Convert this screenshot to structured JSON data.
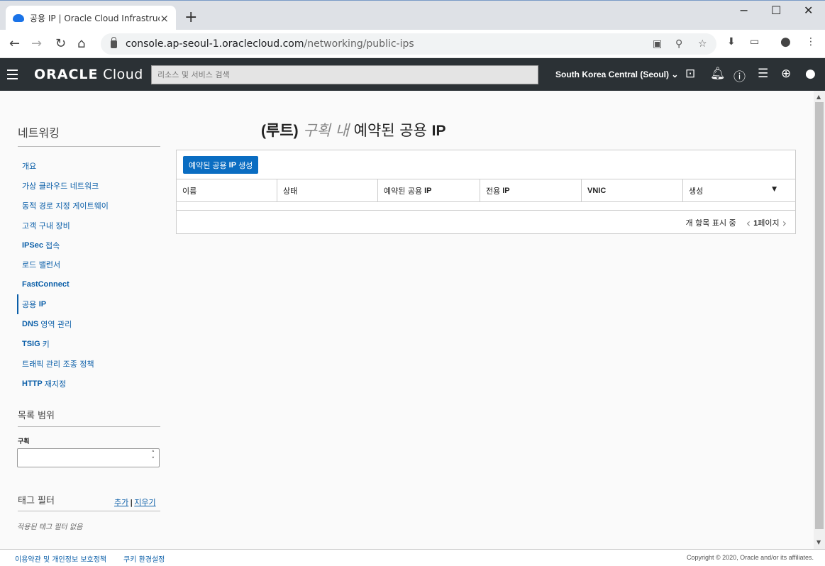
{
  "browser": {
    "tab_title": "공용 IP | Oracle Cloud Infrastructure",
    "tab_close": "×",
    "new_tab": "+",
    "url_host": "console.ap-seoul-1.oraclecloud.com",
    "url_path": "/networking/public-ips",
    "window_controls": [
      "−",
      "☐",
      "✕"
    ]
  },
  "header": {
    "logo_brand": "ORACLE",
    "logo_product": "Cloud",
    "search_placeholder": "리소스 및 서비스 검색",
    "region": "South Korea Central (Seoul)",
    "region_caret": "⌄",
    "icons": [
      "cloud-shell-icon",
      "bell-icon",
      "help-icon",
      "chat-icon",
      "globe-icon",
      "user-icon"
    ]
  },
  "sidebar": {
    "title": "네트워킹",
    "items": [
      {
        "label": "개요",
        "bold": ""
      },
      {
        "label": "가상 클라우드 네트워크",
        "bold": ""
      },
      {
        "label": "동적 경로 지정 게이트웨이",
        "bold": ""
      },
      {
        "label": "고객 구내 장비",
        "bold": ""
      },
      {
        "label": "접속",
        "bold": "IPSec"
      },
      {
        "label": "로드 밸런서",
        "bold": ""
      },
      {
        "label": "",
        "bold": "FastConnect"
      },
      {
        "label": "공용",
        "bold": "",
        "suffix": "IP",
        "active": true
      },
      {
        "label": "영역 관리",
        "bold": "DNS"
      },
      {
        "label": "키",
        "bold": "TSIG"
      },
      {
        "label": "트래픽 관리 조종 정책",
        "bold": ""
      },
      {
        "label": "재지정",
        "bold": "HTTP"
      }
    ],
    "list_scope_title": "목록 범위",
    "compartment_label": "구획",
    "compartment_value": "",
    "tag_filter_title": "태그 필터",
    "tag_add": "추가",
    "tag_sep": "|",
    "tag_clear": "지우기",
    "tag_empty": "적용된 태그 필터 없음"
  },
  "main": {
    "title_root": "(루트)",
    "title_compartment": "구획 내",
    "title_text": "예약된 공용",
    "title_ip": "IP",
    "create_button_pre": "예약된 공용",
    "create_button_ip": "IP",
    "create_button_post": "생성",
    "columns": [
      {
        "label": "이름",
        "latin": ""
      },
      {
        "label": "상태",
        "latin": ""
      },
      {
        "label": "예약된 공용",
        "latin": "IP"
      },
      {
        "label": "전용",
        "latin": "IP"
      },
      {
        "label": "",
        "latin": "VNIC"
      },
      {
        "label": "생성",
        "latin": ""
      }
    ],
    "sort_indicator": "▼",
    "pager_shown": "개 항목 표시 중",
    "pager_prev": "‹",
    "pager_page_num": "1",
    "pager_page_label": "페이지",
    "pager_next": "›"
  },
  "footer": {
    "terms": "이용약관 및 개인정보 보호정책",
    "cookies": "쿠키 환경설정",
    "copyright": "Copyright © 2020, Oracle and/or its affiliates."
  }
}
